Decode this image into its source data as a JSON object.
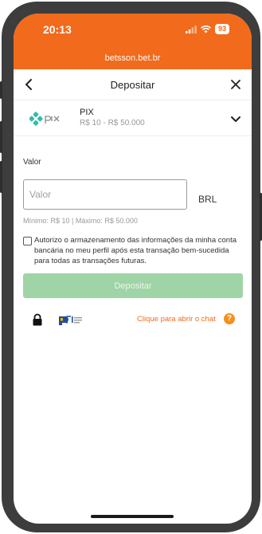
{
  "status_bar": {
    "time": "20:13",
    "battery": "93"
  },
  "browser": {
    "url": "betsson.bet.br"
  },
  "header": {
    "title": "Depositar"
  },
  "payment_method": {
    "name": "PIX",
    "range": "R$ 10 - R$ 50.000"
  },
  "form": {
    "amount_label": "Valor",
    "amount_placeholder": "Valor",
    "amount_value": "",
    "currency": "BRL",
    "limits": "Mínimo: R$ 10 | Máximo: R$ 50.000",
    "consent_text": "Autorizo o armazenamento das informações da minha conta bancária no meu perfil após esta transação bem-sucedida para todas as transações futuras.",
    "consent_checked": false,
    "submit_label": "Depositar"
  },
  "footer": {
    "chat_link": "Clique para abrir o chat",
    "help_symbol": "?"
  },
  "colors": {
    "brand": "#f26a1b",
    "deposit_button": "#9fd4a6",
    "pix": "#32bcad"
  },
  "icons": [
    "back-arrow-icon",
    "close-icon",
    "pix-logo",
    "chevron-down-icon",
    "lock-icon",
    "pci-dss-badge",
    "help-icon",
    "wifi-icon",
    "signal-icon"
  ]
}
